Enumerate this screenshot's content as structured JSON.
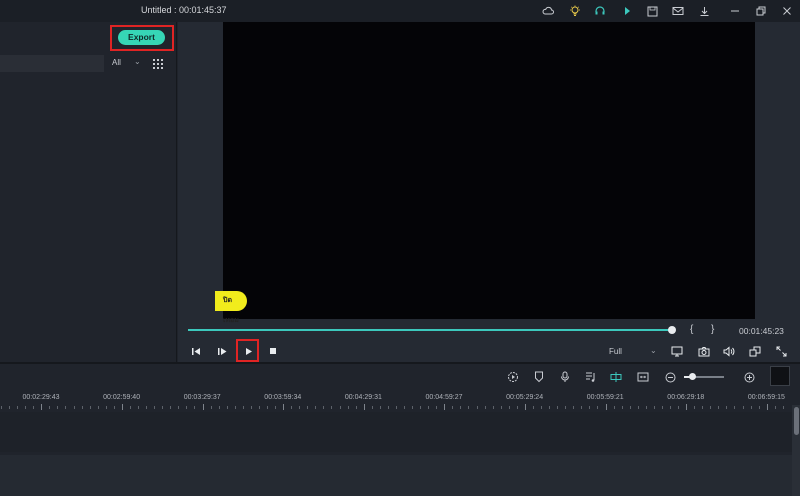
{
  "window": {
    "title": "Untitled : 00:01:45:37",
    "icons": [
      "cloud-icon",
      "lightbulb-icon",
      "headset-icon",
      "arrow-icon",
      "save-icon",
      "mail-icon",
      "download-icon",
      "minimize-icon",
      "restore-icon",
      "close-icon"
    ]
  },
  "left_panel": {
    "export_label": "Export",
    "filter_label": "All"
  },
  "preview": {
    "sticker_text": "ปิดเทอม",
    "open_brace": "{",
    "close_brace": "}",
    "timecode": "00:01:45:23",
    "quality_label": "Full",
    "scrub_progress": 0.99
  },
  "timeline": {
    "ruler_labels": [
      "00:02:29:43",
      "00:02:59:40",
      "00:03:29:37",
      "00:03:59:34",
      "00:04:29:31",
      "00:04:59:27",
      "00:05:29:24",
      "00:05:59:21",
      "00:06:29:18",
      "00:06:59:15"
    ],
    "zoom_level": 0.2
  },
  "colors": {
    "accent": "#36d6b6",
    "highlight": "#e02424",
    "background": "#1f232b"
  }
}
